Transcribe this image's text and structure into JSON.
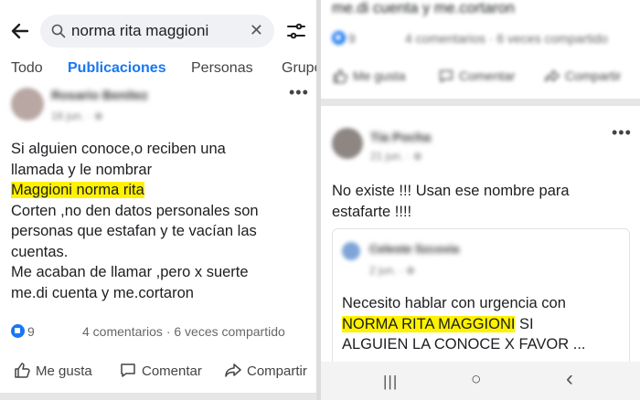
{
  "search": {
    "query": "norma rita maggioni",
    "clear_glyph": "✕"
  },
  "tabs": [
    "Todo",
    "Publicaciones",
    "Personas",
    "Grupos"
  ],
  "post1": {
    "author": "Rosario Benítez",
    "date": "16 jun. · ⊕",
    "body_lines": [
      "Si alguien conoce,o reciben una",
      "llamada y le nombrar"
    ],
    "highlight": "Maggioni norma rita",
    "body_lines2": [
      "Corten ,no den datos personales son",
      "personas que estafan y te vacían las",
      "cuentas.",
      "Me acaban de llamar ,pero x suerte",
      "me.di cuenta y me.cortaron"
    ],
    "reactions": "9",
    "comments_shares": "4 comentarios · 6 veces compartido",
    "actions": {
      "like": "Me gusta",
      "comment": "Comentar",
      "share": "Compartir"
    }
  },
  "right_top": {
    "text": "me.di cuenta y me.cortaron",
    "reactions": "9",
    "comments_shares": "4 comentarios · 6 veces compartido",
    "actions": {
      "like": "Me gusta",
      "comment": "Comentar",
      "share": "Compartir"
    }
  },
  "post2": {
    "author": "Tía Pocha",
    "date": "21 jun. · ⊕",
    "body_lines": [
      "No existe !!! Usan ese nombre para",
      "estafarte !!!!"
    ]
  },
  "quoted": {
    "author": "Celeste Szcovia",
    "date": "2 jun. · ⊕",
    "line1": "Necesito hablar con urgencia con",
    "highlight": "NORMA RITA MAGGIONI",
    "after_highlight": " SI",
    "line3": "ALGUIEN LA CONOCE X FAVOR ..."
  },
  "navbar": {
    "recents": "|||",
    "home": "○",
    "back": "‹"
  },
  "colors": {
    "accent": "#1877f2",
    "highlight": "#fff200"
  }
}
